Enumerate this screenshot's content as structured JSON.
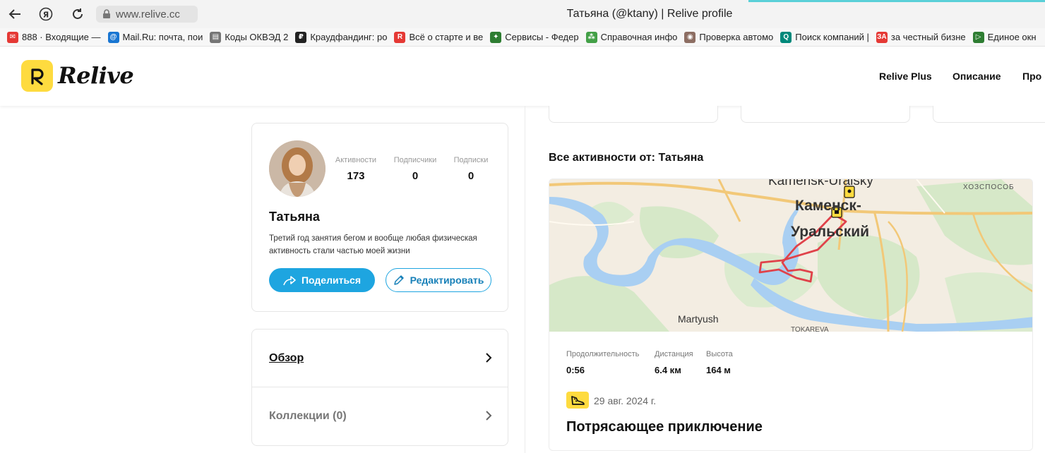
{
  "browser": {
    "url": "www.relive.cc",
    "tab_title": "Татьяна (@ktany) | Relive profile",
    "bookmarks": [
      {
        "label": "888 · Входящие —",
        "color": "#e53935",
        "glyph": "✉"
      },
      {
        "label": "Mail.Ru: почта, пои",
        "color": "#1976d2",
        "glyph": "@"
      },
      {
        "label": "Коды ОКВЭД 2",
        "color": "#757575",
        "glyph": "▤"
      },
      {
        "label": "Краудфандинг: ро",
        "color": "#222222",
        "glyph": "₽"
      },
      {
        "label": "Всё о старте и ве",
        "color": "#e53935",
        "glyph": "R"
      },
      {
        "label": "Сервисы - Федер",
        "color": "#2e7d32",
        "glyph": "✦"
      },
      {
        "label": "Справочная инфо",
        "color": "#43a047",
        "glyph": "⁂"
      },
      {
        "label": "Проверка автомо",
        "color": "#8d6e63",
        "glyph": "◉"
      },
      {
        "label": "Поиск компаний |",
        "color": "#00897b",
        "glyph": "Q"
      },
      {
        "label": "за честный бизне",
        "color": "#e53935",
        "glyph": "ЗА"
      },
      {
        "label": "Единое окн",
        "color": "#2e7d32",
        "glyph": "▷"
      }
    ]
  },
  "site": {
    "logo_text": "Relive",
    "nav": [
      "Relive Plus",
      "Описание",
      "Про"
    ]
  },
  "profile": {
    "name": "Татьяна",
    "bio": "Третий год занятия бегом и вообще любая физическая активность стали частью моей жизни",
    "stats": [
      {
        "label": "Активности",
        "value": "173"
      },
      {
        "label": "Подписчики",
        "value": "0"
      },
      {
        "label": "Подписки",
        "value": "0"
      }
    ],
    "share_label": "Поделиться",
    "edit_label": "Редактировать"
  },
  "menu": {
    "overview": "Обзор",
    "collections": "Коллекции (0)"
  },
  "activities": {
    "section_title": "Все активности от: Татьяна",
    "item": {
      "map_labels": {
        "city_latin": "Kamensk-Uralsky",
        "city_line1": "Каменск-",
        "city_line2": "Уральский",
        "village1": "Martyush",
        "village2": "TOKAREVA",
        "area": "ХОЗСПОСОБ"
      },
      "metrics": [
        {
          "label": "Продолжительность",
          "value": "0:56"
        },
        {
          "label": "Дистанция",
          "value": "6.4 км"
        },
        {
          "label": "Высота",
          "value": "164 м"
        }
      ],
      "date": "29 авг. 2024 г.",
      "title": "Потрясающее приключение"
    }
  },
  "colors": {
    "accent": "#1ea5e0",
    "brand_yellow": "#fedb3f",
    "route": "#e0424a"
  }
}
